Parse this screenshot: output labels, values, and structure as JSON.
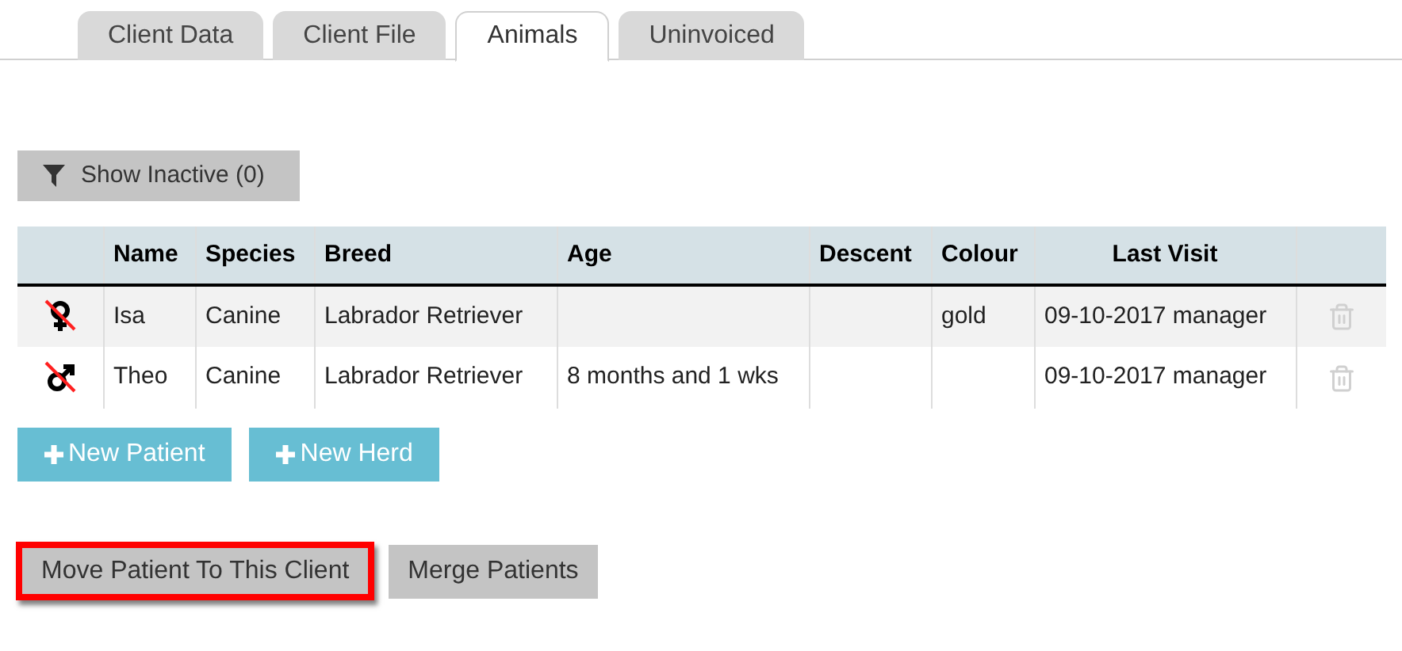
{
  "tabs": [
    {
      "label": "Client Data",
      "selected": false
    },
    {
      "label": "Client File",
      "selected": false
    },
    {
      "label": "Animals",
      "selected": true
    },
    {
      "label": "Uninvoiced",
      "selected": false
    }
  ],
  "filter_button": {
    "label": "Show Inactive (0)"
  },
  "table": {
    "columns": [
      "Name",
      "Species",
      "Breed",
      "Age",
      "Descent",
      "Colour",
      "Last Visit"
    ],
    "rows": [
      {
        "kind": "female",
        "neutered": true,
        "cells": [
          "Isa",
          "Canine",
          "Labrador Retriever",
          "",
          "",
          "gold",
          "09-10-2017 manager"
        ]
      },
      {
        "kind": "male",
        "neutered": true,
        "cells": [
          "Theo",
          "Canine",
          "Labrador Retriever",
          "8 months and 1 wks",
          "",
          "",
          "09-10-2017 manager"
        ]
      }
    ]
  },
  "add_buttons": [
    "New Patient",
    "New Herd"
  ],
  "action_buttons": [
    {
      "label": "Move Patient To This Client",
      "highlighted": true
    },
    {
      "label": "Merge Patients",
      "highlighted": false
    }
  ]
}
